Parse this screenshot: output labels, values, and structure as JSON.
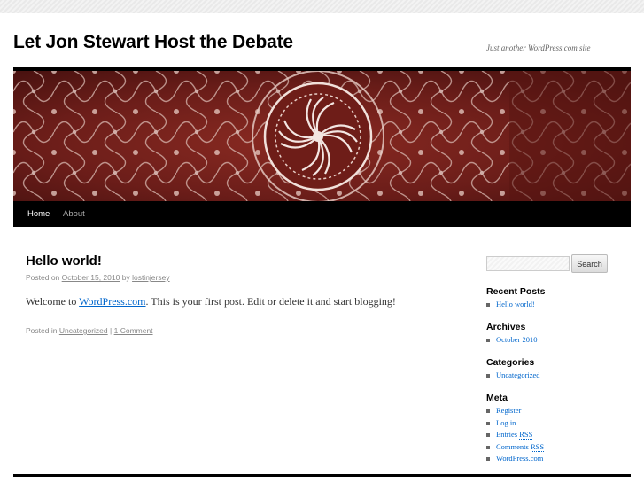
{
  "site": {
    "title": "Let Jon Stewart Host the Debate",
    "description": "Just another WordPress.com site"
  },
  "nav": {
    "items": [
      {
        "label": "Home",
        "current": true
      },
      {
        "label": "About",
        "current": false
      }
    ]
  },
  "post": {
    "title": "Hello world!",
    "meta_prefix": "Posted on",
    "date": "October 15, 2010",
    "meta_by": "by",
    "author": "lostinjersey",
    "content_before": "Welcome to",
    "content_link": "WordPress.com",
    "content_after": ". This is your first post. Edit or delete it and start blogging!",
    "posted_in": "Posted in",
    "category": "Uncategorized",
    "separator": "|",
    "comments": "1 Comment"
  },
  "sidebar": {
    "search": {
      "placeholder": "",
      "button": "Search"
    },
    "recent_posts": {
      "title": "Recent Posts",
      "items": [
        "Hello world!"
      ]
    },
    "archives": {
      "title": "Archives",
      "items": [
        "October 2010"
      ]
    },
    "categories": {
      "title": "Categories",
      "items": [
        "Uncategorized"
      ]
    },
    "meta": {
      "title": "Meta",
      "items": [
        "Register",
        "Log in",
        "Entries",
        "RSS",
        "Comments",
        "RSS",
        "WordPress.com"
      ]
    }
  },
  "colors": {
    "link": "#0066cc",
    "nav_bg": "#000000",
    "header_red": "#7a201b"
  }
}
